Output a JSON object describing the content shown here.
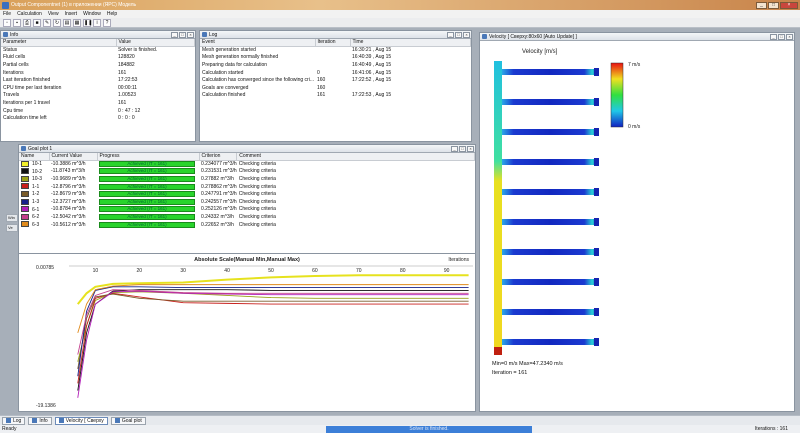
{
  "app": {
    "title": "Output Componentnet (1) в приложении (ЯРС) Модель"
  },
  "menu": [
    "File",
    "Calculation",
    "View",
    "Insert",
    "Window",
    "Help"
  ],
  "info": {
    "title": "Info",
    "columns": [
      "Parameter",
      "Value"
    ],
    "rows": [
      [
        "Status",
        "Solver is finished."
      ],
      [
        "Fluid cells",
        "128820"
      ],
      [
        "Partial cells",
        "184882"
      ],
      [
        "Iterations",
        "161"
      ],
      [
        "Last iteration finished",
        "17:22:53"
      ],
      [
        "CPU time per last iteration",
        "00:00:11"
      ],
      [
        "Travels",
        "1.00523"
      ],
      [
        "Iterations per 1 travel",
        "161"
      ],
      [
        "Cpu time",
        "0 : 47 : 12"
      ],
      [
        "Calculation time left",
        "0 : 0 : 0"
      ]
    ]
  },
  "log": {
    "title": "Log",
    "columns": [
      "Event",
      "Iteration",
      "Time"
    ],
    "rows": [
      [
        "Mesh generation started",
        "",
        "16:30:21 , Aug 15"
      ],
      [
        "Mesh generation normally finished",
        "",
        "16:40:39 , Aug 15"
      ],
      [
        "Preparing data for calculation",
        "",
        "16:40:49 , Aug 15"
      ],
      [
        "Calculation started",
        "0",
        "16:41:06 , Aug 15"
      ],
      [
        "Calculation has converged since the following cri...",
        "160",
        "17:22:52 , Aug 15"
      ],
      [
        "Goals are converged",
        "160",
        ""
      ],
      [
        "Calculation finished",
        "161",
        "17:22:53 , Aug 15"
      ]
    ]
  },
  "velocity": {
    "title": "Velocity [ Сверху:80х60 [Auto Update] ]",
    "legend_title": "Velocity [m/s]",
    "max_label": "7 m/s",
    "min_label": "0 m/s",
    "minmax_text": "Min=0 m/s    Max=47.2340 m/s",
    "iteration_text": "Iteration = 161"
  },
  "goals": {
    "title": "Goal plot 1",
    "columns": [
      "Name",
      "Current Value",
      "Progress",
      "Criterion",
      "Comment"
    ],
    "rows": [
      {
        "color": "#f2ef2a",
        "name": "10-1",
        "value": "-10.3886 m^3/h",
        "progress": "Achieved (IT = 161)",
        "criterion": "0.234077 m^3/h",
        "comment": "Checking criteria"
      },
      {
        "color": "#111111",
        "name": "10-2",
        "value": "-11.8743 m^3/h",
        "progress": "Achieved (IT = 161)",
        "criterion": "0.231531 m^3/h",
        "comment": "Checking criteria"
      },
      {
        "color": "#9aa018",
        "name": "10-3",
        "value": "-10.9689 m^3/h",
        "progress": "Achieved (IT = 161)",
        "criterion": "0.27882 m^3/h",
        "comment": "Checking criteria"
      },
      {
        "color": "#c8201c",
        "name": "1-1",
        "value": "-12.8796 m^3/h",
        "progress": "Achieved (IT = 161)",
        "criterion": "0.278862 m^3/h",
        "comment": "Checking criteria"
      },
      {
        "color": "#7a5c2a",
        "name": "1-2",
        "value": "-12.8679 m^3/h",
        "progress": "Achieved (IT = 161)",
        "criterion": "0.247791 m^3/h",
        "comment": "Checking criteria"
      },
      {
        "color": "#18228a",
        "name": "1-3",
        "value": "-12.3727 m^3/h",
        "progress": "Achieved (IT = 161)",
        "criterion": "0.242557 m^3/h",
        "comment": "Checking criteria"
      },
      {
        "color": "#b21fb8",
        "name": "6-1",
        "value": "-10.8784 m^3/h",
        "progress": "Achieved (IT = 161)",
        "criterion": "0.252126 m^3/h",
        "comment": "Checking criteria"
      },
      {
        "color": "#c43e8c",
        "name": "6-2",
        "value": "-12.5042 m^3/h",
        "progress": "Achieved (IT = 161)",
        "criterion": "0.24332 m^3/h",
        "comment": "Checking criteria"
      },
      {
        "color": "#e08a1c",
        "name": "6-3",
        "value": "-10.5612 m^3/h",
        "progress": "Achieved (IT = 161)",
        "criterion": "0.22652 m^3/h",
        "comment": "Checking criteria"
      }
    ]
  },
  "chart_data": {
    "type": "line",
    "title": "Absolute Scale(Manual Min,Manual Max)",
    "xlabel": "Iterations",
    "ymax_label": "0.00785",
    "ymin_label": "-19.1386",
    "xlim": [
      4,
      96
    ],
    "ylim": [
      -19.1386,
      0.00785
    ],
    "xticks": [
      10,
      20,
      30,
      40,
      50,
      60,
      70,
      80,
      90
    ],
    "series": [
      {
        "name": "10-1",
        "color": "#e6e21e",
        "x": [
          6,
          8,
          10,
          14,
          20,
          30,
          40,
          50,
          60,
          70,
          80,
          95
        ],
        "y": [
          -5,
          -3.5,
          -2.6,
          -2.2,
          -2.1,
          -2.0,
          -1.6,
          -1.3,
          -1.1,
          -1.0,
          -1.0,
          -1.0
        ]
      },
      {
        "name": "10-2",
        "color": "#111111",
        "x": [
          6,
          8,
          10,
          14,
          20,
          30,
          40,
          50,
          60,
          70,
          80,
          95
        ],
        "y": [
          -17,
          -9,
          -5,
          -3.2,
          -3.0,
          -3.0,
          -3.0,
          -3.1,
          -3.1,
          -3.1,
          -3.1,
          -3.1
        ]
      },
      {
        "name": "10-3",
        "color": "#9aa018",
        "x": [
          6,
          8,
          10,
          14,
          20,
          30,
          40,
          50,
          60,
          70,
          80,
          95
        ],
        "y": [
          -13,
          -8,
          -4.5,
          -3.4,
          -3.3,
          -3.5,
          -3.8,
          -4.1,
          -4.2,
          -4.2,
          -4.2,
          -4.2
        ]
      },
      {
        "name": "1-1",
        "color": "#c8201c",
        "x": [
          6,
          8,
          10,
          14,
          20,
          30,
          40,
          50,
          60,
          70,
          80,
          95
        ],
        "y": [
          -16,
          -8,
          -4.2,
          -3.5,
          -4.0,
          -4.8,
          -4.9,
          -5.0,
          -5.0,
          -5.0,
          -5.0,
          -5.0
        ]
      },
      {
        "name": "1-2",
        "color": "#7a5c2a",
        "x": [
          6,
          8,
          10,
          14,
          20,
          30,
          40,
          50,
          60,
          70,
          80,
          95
        ],
        "y": [
          -14,
          -7,
          -4,
          -3.6,
          -4.2,
          -4.6,
          -4.6,
          -4.6,
          -4.6,
          -4.6,
          -4.6,
          -4.6
        ]
      },
      {
        "name": "1-3",
        "color": "#18228a",
        "x": [
          6,
          8,
          10,
          14,
          20,
          30,
          40,
          50,
          60,
          70,
          80,
          95
        ],
        "y": [
          -15,
          -6,
          -3.1,
          -2.6,
          -2.6,
          -2.7,
          -2.7,
          -2.7,
          -2.7,
          -2.7,
          -2.7,
          -2.7
        ]
      },
      {
        "name": "6-1",
        "color": "#b21fb8",
        "x": [
          6,
          8,
          10,
          14,
          20,
          30,
          40,
          50,
          60,
          70,
          80,
          95
        ],
        "y": [
          -18,
          -10,
          -5,
          -3.3,
          -3.2,
          -3.5,
          -3.6,
          -3.7,
          -3.7,
          -3.7,
          -3.7,
          -3.7
        ]
      },
      {
        "name": "6-2",
        "color": "#c43e8c",
        "x": [
          6,
          8,
          10,
          14,
          20,
          30,
          40,
          50,
          60,
          70,
          80,
          95
        ],
        "y": [
          -12,
          -6.5,
          -3.8,
          -3.0,
          -3.1,
          -3.4,
          -3.5,
          -3.5,
          -3.5,
          -3.5,
          -3.5,
          -3.5
        ]
      },
      {
        "name": "6-3",
        "color": "#e08a1c",
        "x": [
          6,
          8,
          10,
          14,
          20,
          30,
          40,
          50,
          60,
          70,
          80,
          95
        ],
        "y": [
          -9,
          -5,
          -3.0,
          -2.5,
          -2.3,
          -2.3,
          -2.3,
          -2.3,
          -2.3,
          -2.3,
          -2.3,
          -2.3
        ]
      }
    ]
  },
  "taskbar": [
    "Log",
    "Info",
    "Velocity [ Сверху",
    "Goal plot"
  ],
  "status": {
    "ready": "Ready",
    "solver": "Solver is finished.",
    "iterations": "Iterations : 161"
  }
}
